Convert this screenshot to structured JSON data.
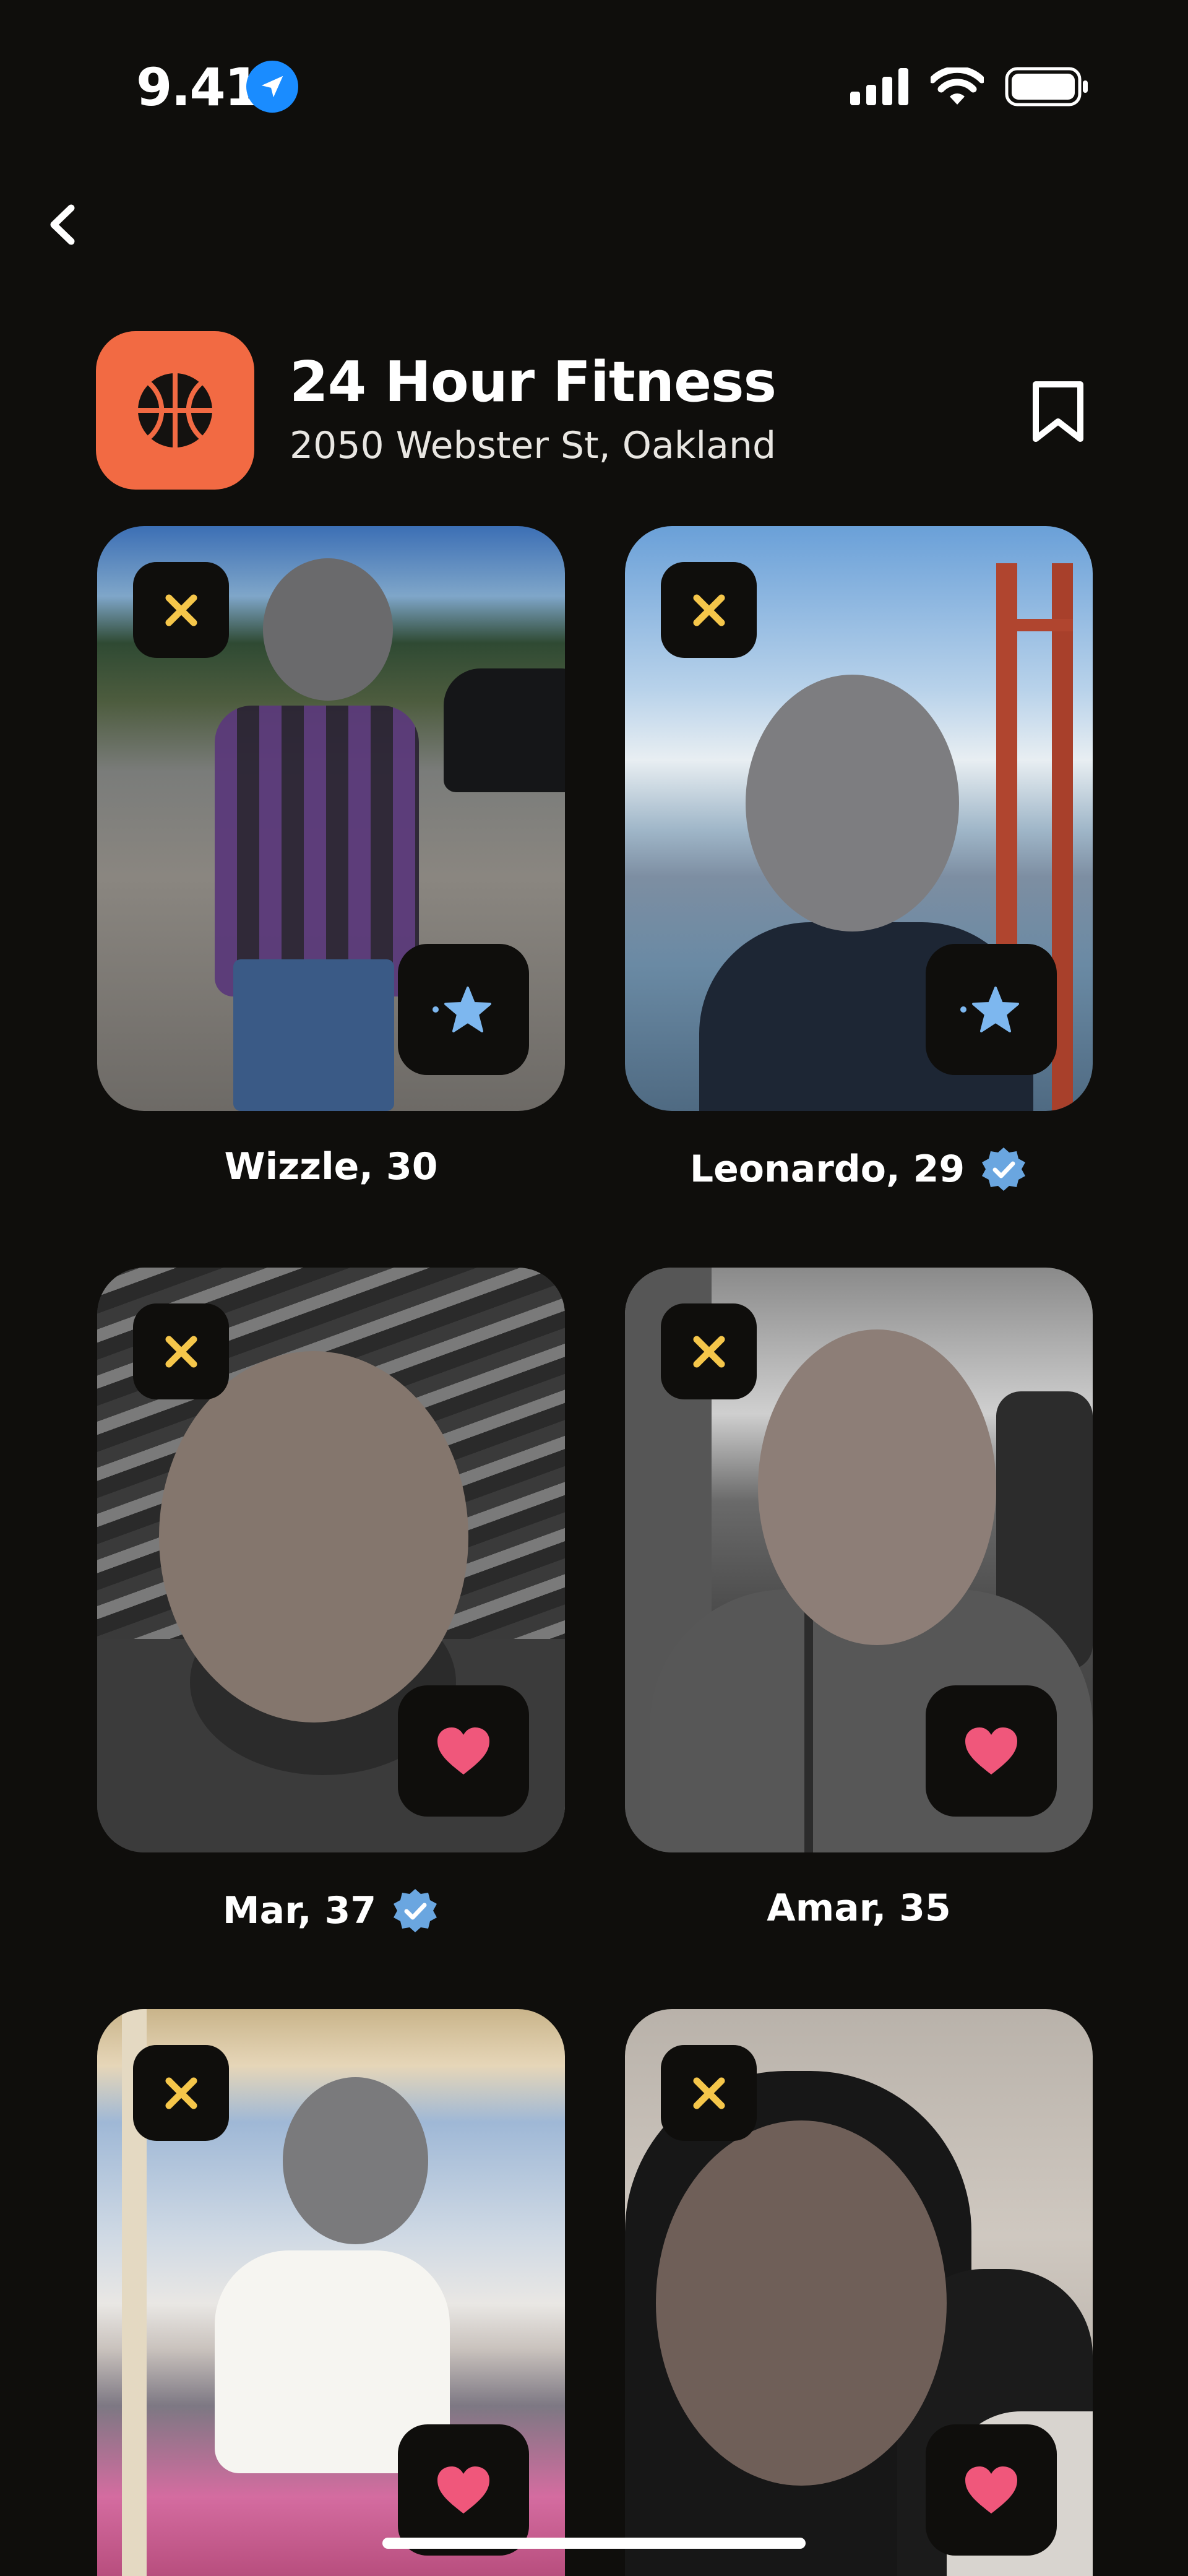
{
  "status_bar": {
    "time": "9.41",
    "battery": "full"
  },
  "header": {
    "venue_name": "24 Hour Fitness",
    "venue_address": "2050 Webster St, Oakland",
    "logo_icon": "basketball-icon",
    "logo_color": "#f26a43"
  },
  "profiles": [
    {
      "label": "Wizzle, 30",
      "verified": false,
      "action": "super-like"
    },
    {
      "label": "Leonardo, 29",
      "verified": true,
      "action": "super-like"
    },
    {
      "label": "Mar, 37",
      "verified": true,
      "action": "like"
    },
    {
      "label": "Amar, 35",
      "verified": false,
      "action": "like"
    },
    {
      "label": "",
      "verified": false,
      "action": "like"
    },
    {
      "label": "",
      "verified": false,
      "action": "like"
    }
  ],
  "colors": {
    "background": "#0f0e0c",
    "dismiss_x": "#f5c64a",
    "star": "#7db7ef",
    "heart": "#f0577b",
    "verified_badge": "#6aa6e0"
  }
}
